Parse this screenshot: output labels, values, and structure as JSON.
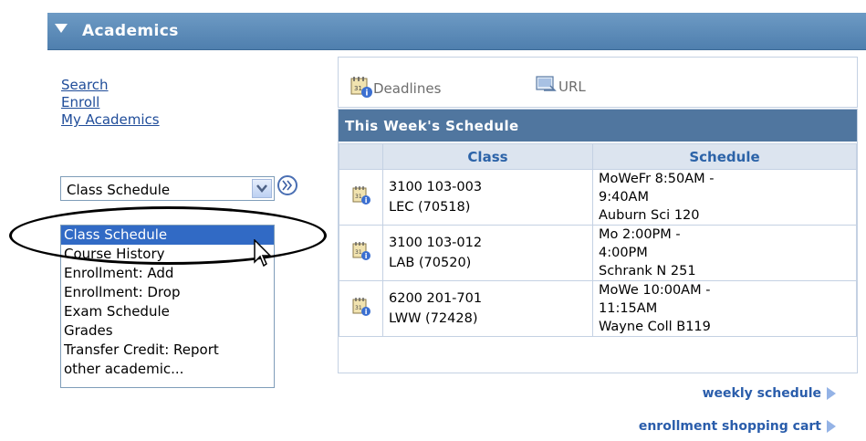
{
  "header": {
    "title": "Academics"
  },
  "links": [
    "Search",
    "Enroll",
    "My Academics"
  ],
  "select": {
    "value": "Class Schedule"
  },
  "listbox": {
    "options": [
      "Class Schedule",
      "Course History",
      "Enrollment: Add",
      "Enrollment: Drop",
      "Exam Schedule",
      "Grades",
      "Transfer Credit: Report",
      "other academic..."
    ],
    "selected_index": 0
  },
  "toolbar": {
    "deadlines": "Deadlines",
    "url": "URL"
  },
  "schedule": {
    "title": "This Week's Schedule",
    "columns": {
      "class": "Class",
      "schedule": "Schedule"
    },
    "rows": [
      {
        "class_line1": "3100 103-003",
        "class_line2": "LEC (70518)",
        "sched_line1": "MoWeFr 8:50AM -",
        "sched_line2": "9:40AM",
        "sched_line3": "Auburn Sci 120"
      },
      {
        "class_line1": "3100 103-012",
        "class_line2": "LAB (70520)",
        "sched_line1": "Mo 2:00PM -",
        "sched_line2": "4:00PM",
        "sched_line3": "Schrank N 251"
      },
      {
        "class_line1": "6200 201-701",
        "class_line2": "LWW (72428)",
        "sched_line1": "MoWe 10:00AM -",
        "sched_line2": "11:15AM",
        "sched_line3": "Wayne Coll B119"
      }
    ]
  },
  "footer": {
    "weekly_schedule": "weekly schedule",
    "shopping_cart": "enrollment shopping cart"
  },
  "colors": {
    "header_bg": "#5b8ab9",
    "schedule_title_bg": "#50769f",
    "link": "#1f4c99",
    "selected": "#316ac5"
  }
}
